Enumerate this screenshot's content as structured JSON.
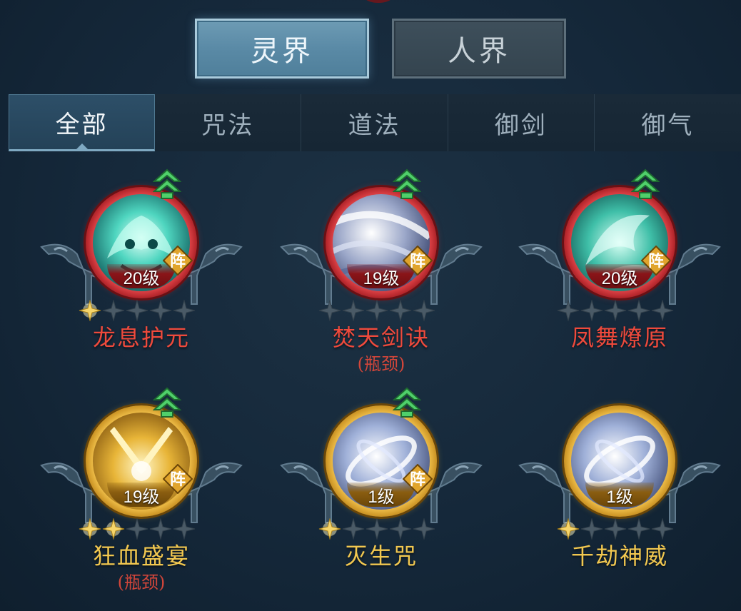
{
  "realm_tabs": [
    {
      "label": "灵界",
      "active": true
    },
    {
      "label": "人界",
      "active": false
    }
  ],
  "category_tabs": [
    {
      "label": "全部",
      "active": true
    },
    {
      "label": "咒法",
      "active": false
    },
    {
      "label": "道法",
      "active": false
    },
    {
      "label": "御剑",
      "active": false
    },
    {
      "label": "御气",
      "active": false
    }
  ],
  "badge_text": "阵",
  "skills": [
    {
      "name": "龙息护元",
      "level": "20级",
      "subtitle": "",
      "stars_filled": 1,
      "stars_total": 5,
      "rarity": "red",
      "upgrade": true,
      "formation": true,
      "art": "dragon"
    },
    {
      "name": "焚天剑诀",
      "level": "19级",
      "subtitle": "(瓶颈)",
      "stars_filled": 0,
      "stars_total": 5,
      "rarity": "red",
      "upgrade": true,
      "formation": true,
      "art": "storm"
    },
    {
      "name": "凤舞燎原",
      "level": "20级",
      "subtitle": "",
      "stars_filled": 0,
      "stars_total": 5,
      "rarity": "red",
      "upgrade": true,
      "formation": true,
      "art": "phoenix"
    },
    {
      "name": "狂血盛宴",
      "level": "19级",
      "subtitle": "(瓶颈)",
      "stars_filled": 2,
      "stars_total": 5,
      "rarity": "gold",
      "upgrade": true,
      "formation": true,
      "art": "blades"
    },
    {
      "name": "灭生咒",
      "level": "1级",
      "subtitle": "",
      "stars_filled": 1,
      "stars_total": 5,
      "rarity": "gold",
      "upgrade": true,
      "formation": true,
      "art": "vortex"
    },
    {
      "name": "千劫神威",
      "level": "1级",
      "subtitle": "",
      "stars_filled": 1,
      "stars_total": 5,
      "rarity": "gold",
      "upgrade": false,
      "formation": false,
      "art": "vortex2"
    }
  ],
  "colors": {
    "red_name": "#ef4a3c",
    "gold_name": "#f2c850",
    "star_filled": "#f6d56a",
    "star_empty": "#4a5a66",
    "upgrade_green": "#4fd06a"
  },
  "icons": {
    "upgrade": "double-chevron-up-icon",
    "formation": "formation-badge-icon",
    "star": "star-icon"
  }
}
